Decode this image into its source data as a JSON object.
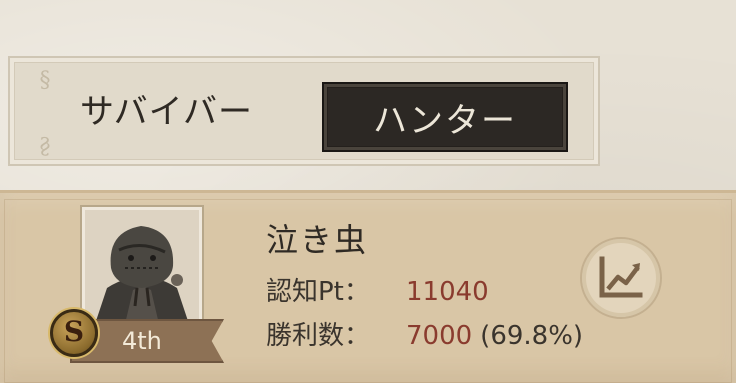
{
  "tabs": {
    "survivor_label": "サバイバー",
    "hunter_label": "ハンター",
    "active": "hunter"
  },
  "character": {
    "name": "泣き虫",
    "rank_label": "4th",
    "tier_badge": "S",
    "portrait_icon": "crybaby-hunter-portrait"
  },
  "stats": {
    "recognition_label": "認知Pt：",
    "recognition_value": "11040",
    "wins_label": "勝利数：",
    "wins_value": "7000",
    "wins_rate": "(69.8%)"
  },
  "icons": {
    "trend": "line-chart-trend-icon",
    "ornament": "corner-ornament-icon"
  },
  "colors": {
    "tab_active_bg": "#2c2824",
    "card_bg": "#d9c6a6",
    "value_red": "#8a3b2e",
    "ribbon": "#8d7155"
  }
}
